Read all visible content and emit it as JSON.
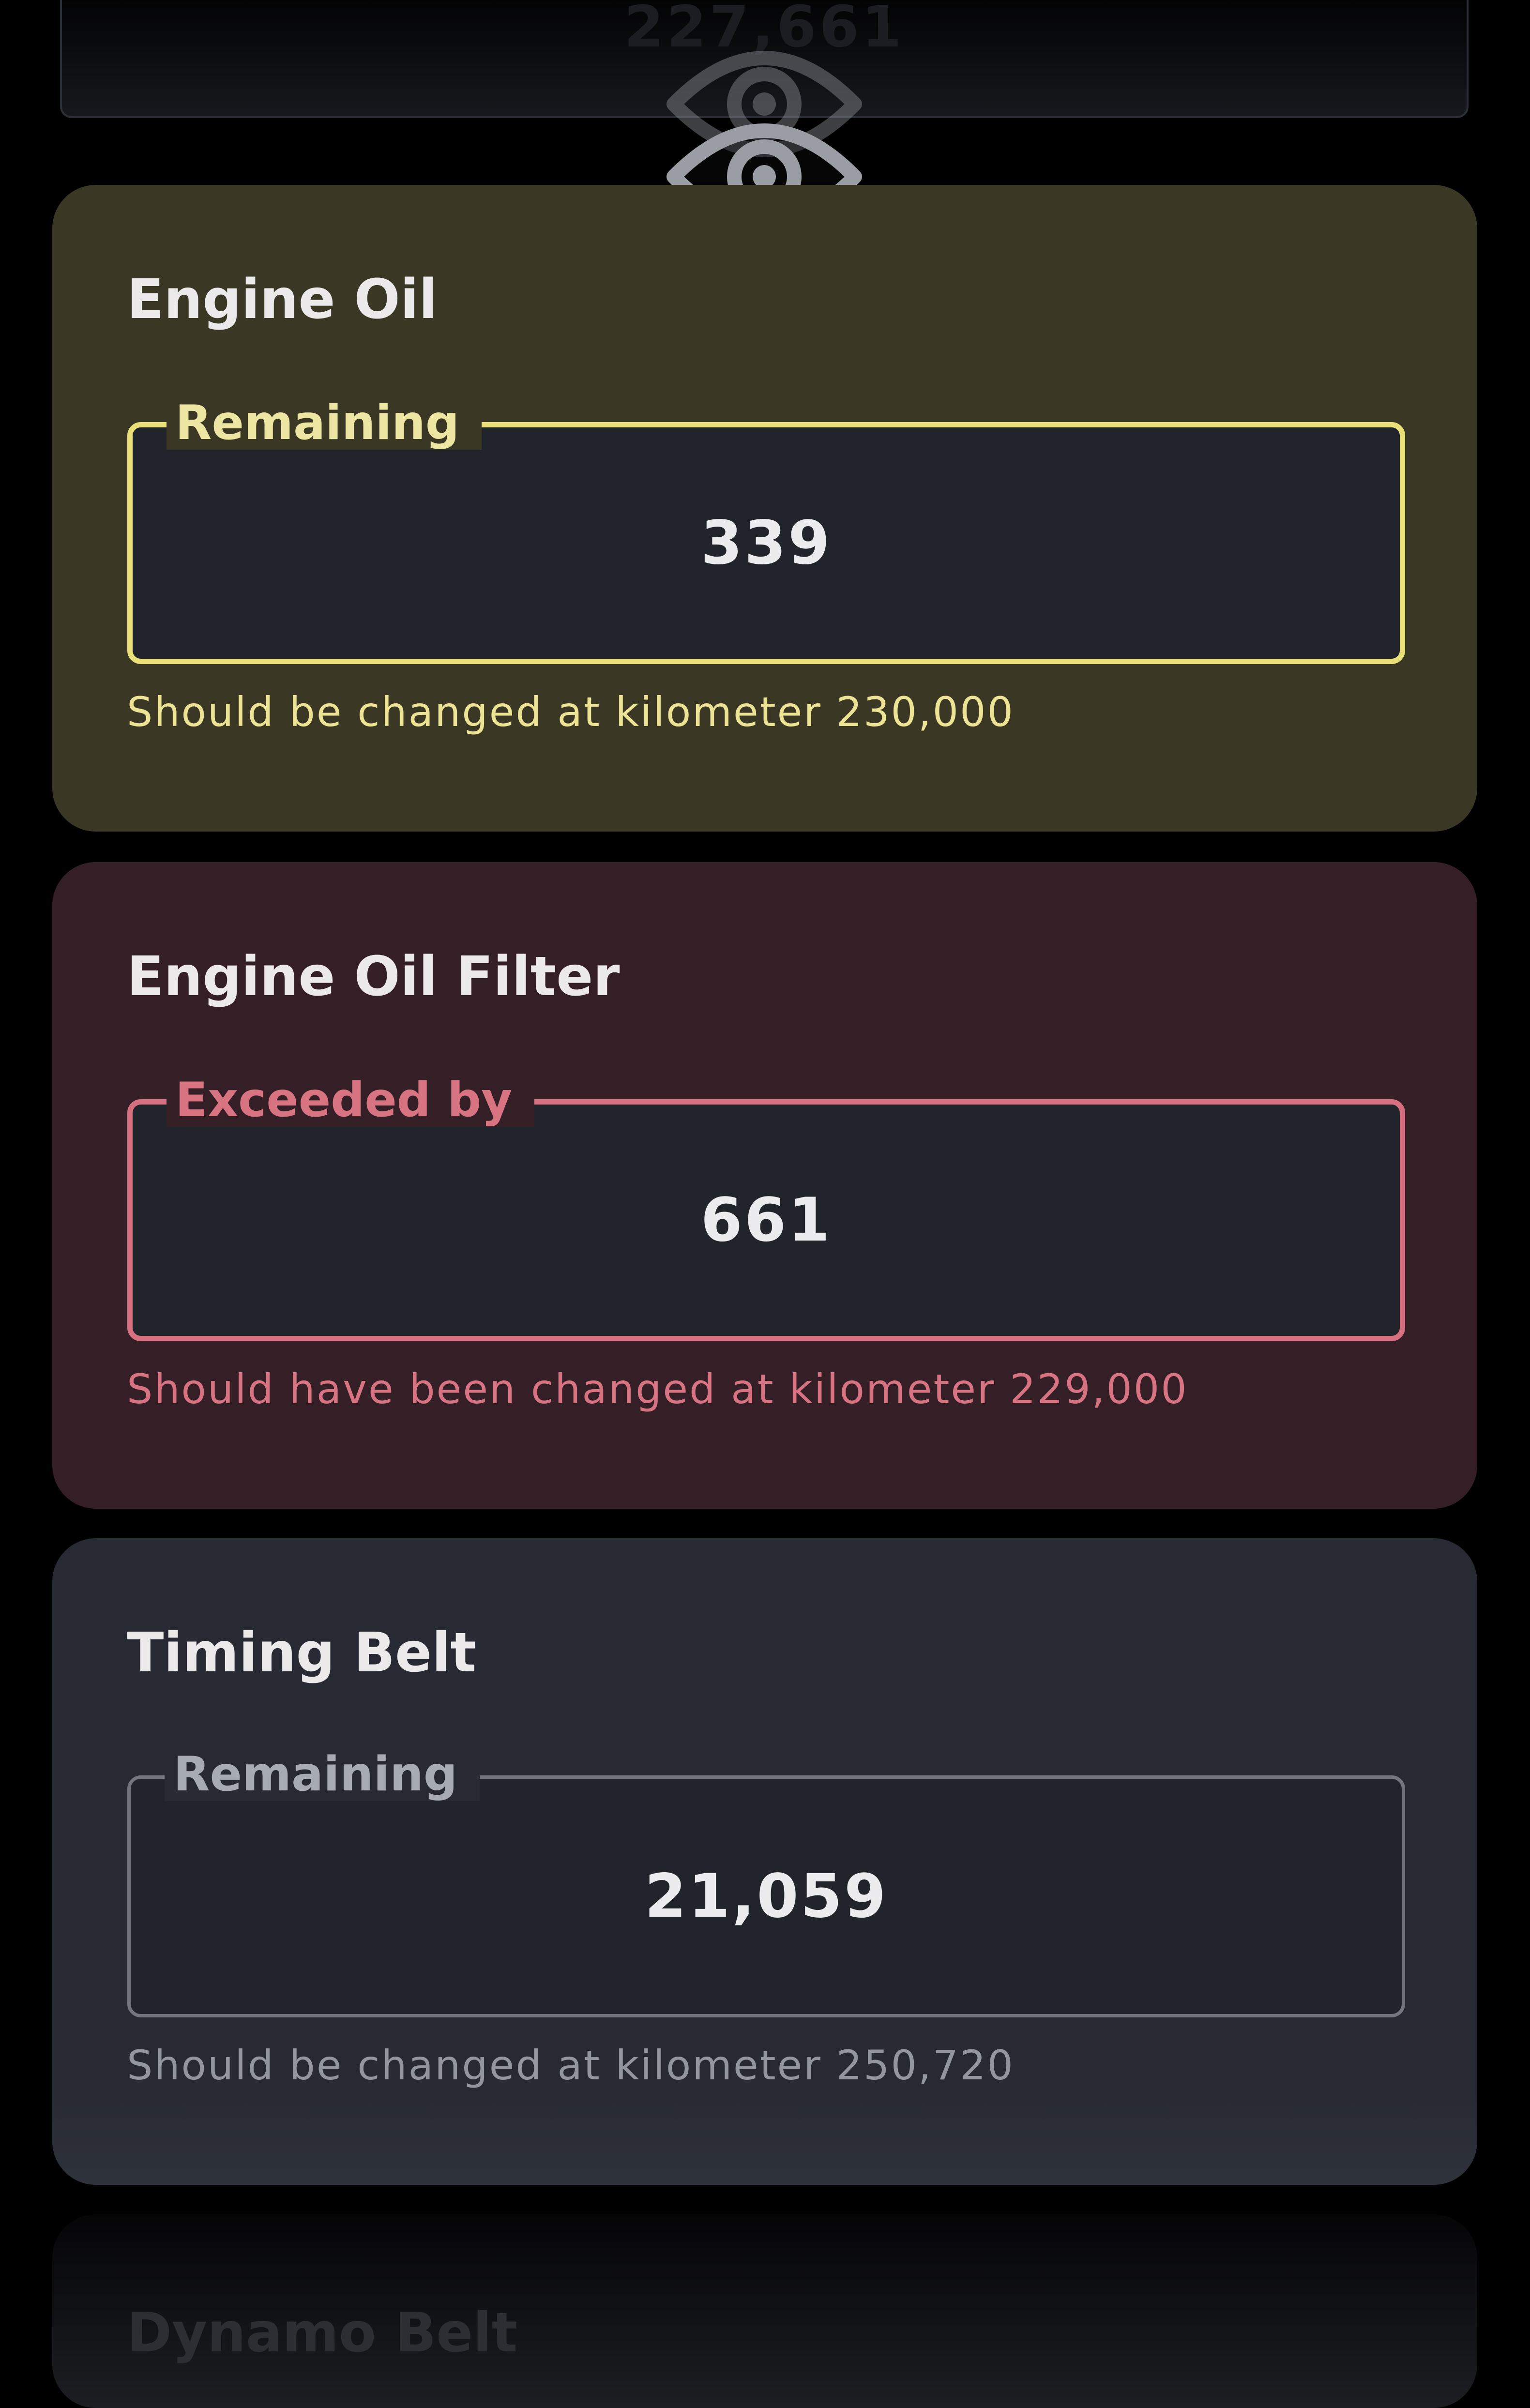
{
  "top_card": {
    "faded_value": "227,661"
  },
  "cards": [
    {
      "title": "Engine Oil",
      "legend": "Remaining",
      "value": "339",
      "helper": "Should be changed at kilometer 230,000",
      "status": "warning",
      "accent": "#e9e07a"
    },
    {
      "title": "Engine Oil Filter",
      "legend": "Exceeded by",
      "value": "661",
      "helper": "Should have been changed at kilometer 229,000",
      "status": "overdue",
      "accent": "#d66f7f"
    },
    {
      "title": "Timing Belt",
      "legend": "Remaining",
      "value": "21,059",
      "helper": "Should be changed at kilometer 250,720",
      "status": "ok",
      "accent": "#71767f"
    }
  ],
  "bottom_card": {
    "faded_title": "Dynamo Belt"
  },
  "icons": {
    "visibility": "eye-icon"
  },
  "colors": {
    "background": "#000000",
    "warning_card": "#3a3725",
    "overdue_card": "#351f27",
    "ok_card": "#272a32"
  }
}
